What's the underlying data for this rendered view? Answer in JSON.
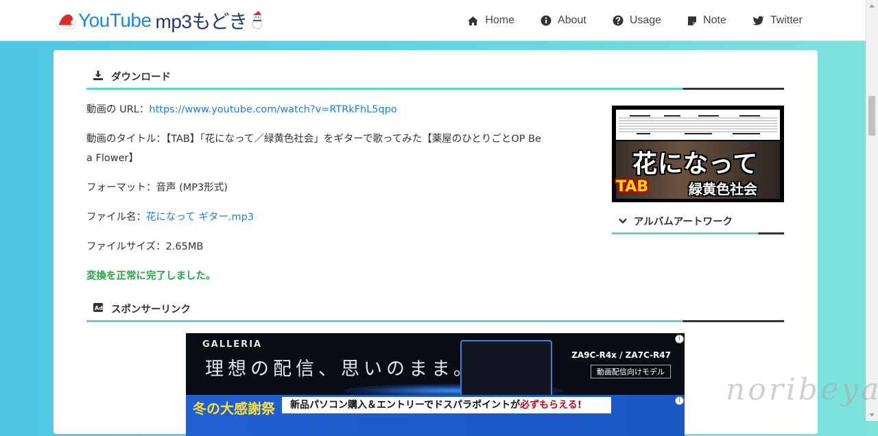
{
  "header": {
    "logo": {
      "part1": "YouTube",
      "part2": "mp3もどき"
    },
    "nav": [
      {
        "label": "Home",
        "icon": "home-icon"
      },
      {
        "label": "About",
        "icon": "info-icon"
      },
      {
        "label": "Usage",
        "icon": "question-icon"
      },
      {
        "label": "Note",
        "icon": "note-icon"
      },
      {
        "label": "Twitter",
        "icon": "twitter-icon"
      }
    ]
  },
  "download": {
    "heading": "ダウンロード",
    "url_label": "動画の URL：",
    "url_value": "https://www.youtube.com/watch?v=RTRkFhL5qpo",
    "title_label": "動画のタイトル：",
    "title_line1": "【TAB】「花になって／緑黄色社会」をギターで歌ってみた【薬屋のひとりごとOP Be",
    "title_line2": "a Flower】",
    "format_label": "フォーマット：",
    "format_value": "音声 (MP3形式)",
    "filename_label": "ファイル名：",
    "filename_value": "花になって ギター.mp3",
    "filesize_label": "ファイルサイズ：",
    "filesize_value": "2.65MB",
    "status": "変換を正常に完了しました。"
  },
  "thumbnail": {
    "big_text": "花になって",
    "tab_text": "TAB",
    "artist_text": "緑黄色社会"
  },
  "album_art": {
    "heading": "アルバムアートワーク"
  },
  "sponsor": {
    "heading": "スポンサーリンク"
  },
  "ad1": {
    "brand": "GALLERIA",
    "copy": "理想の配信、思いのまま。",
    "model": "ZA9C-R4x / ZA7C-R47",
    "sub": "動画配信向けモデル"
  },
  "ad2": {
    "left": "冬の大感謝祭",
    "banner_a": "新品パソコン購入",
    "banner_b": "＆エントリーでドスパラポイントが",
    "banner_red": "必ずもらえる!"
  },
  "watermark": "noribeya"
}
